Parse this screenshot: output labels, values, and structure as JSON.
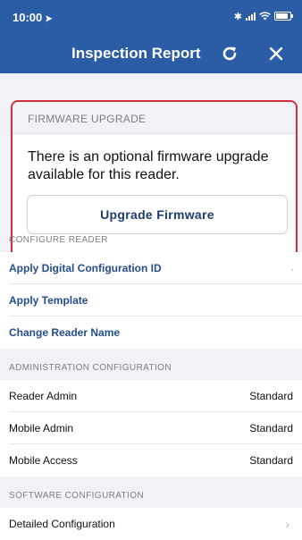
{
  "status_bar": {
    "time": "10:00",
    "location_glyph": "➤",
    "bluetooth_glyph": "✱",
    "icons": [
      "bluetooth-icon",
      "signal-icon",
      "wifi-icon",
      "battery-icon"
    ]
  },
  "header": {
    "title": "Inspection Report",
    "background": "#2a5da6",
    "actions": [
      "refresh-icon",
      "close-icon"
    ]
  },
  "firmware": {
    "section_title": "FIRMWARE UPGRADE",
    "message": "There is an optional firmware upgrade available for this reader.",
    "button_label": "Upgrade Firmware",
    "highlight_color": "#d0303a"
  },
  "configure_reader": {
    "section_title": "CONFIGURE READER",
    "items": [
      {
        "label": "Apply Digital Configuration ID"
      },
      {
        "label": "Apply Template"
      },
      {
        "label": "Change Reader Name"
      }
    ]
  },
  "administration": {
    "section_title": "ADMINISTRATION CONFIGURATION",
    "items": [
      {
        "label": "Reader Admin",
        "value": "Standard"
      },
      {
        "label": "Mobile Admin",
        "value": "Standard"
      },
      {
        "label": "Mobile Access",
        "value": "Standard"
      }
    ]
  },
  "software": {
    "section_title": "SOFTWARE CONFIGURATION",
    "items": [
      {
        "label": "Detailed Configuration",
        "chevron": "›"
      }
    ]
  },
  "colors": {
    "link": "#244e8f",
    "background": "#f2f2f6"
  }
}
